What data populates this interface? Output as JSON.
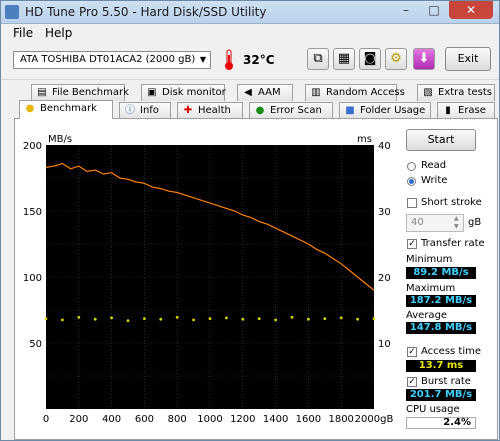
{
  "window": {
    "title": "HD Tune Pro 5.50 - Hard Disk/SSD Utility",
    "minimize": "–",
    "maximize": "□",
    "close": "✕"
  },
  "menu": {
    "file": "File",
    "help": "Help"
  },
  "toolbar": {
    "drive": "ATA     TOSHIBA DT01ACA2 (2000 gB)",
    "temperature": "32°C",
    "exit_label": "Exit"
  },
  "tabs_top": [
    {
      "label": "File Benchmark",
      "icon": "file-icon"
    },
    {
      "label": "Disk monitor",
      "icon": "monitor-icon"
    },
    {
      "label": "AAM",
      "icon": "speaker-icon"
    },
    {
      "label": "Random Access",
      "icon": "random-icon"
    },
    {
      "label": "Extra tests",
      "icon": "tests-icon"
    }
  ],
  "tabs_bottom": [
    {
      "label": "Benchmark",
      "icon": "lightbulb-icon"
    },
    {
      "label": "Info",
      "icon": "info-icon"
    },
    {
      "label": "Health",
      "icon": "health-cross-icon"
    },
    {
      "label": "Error Scan",
      "icon": "magnifier-icon"
    },
    {
      "label": "Folder Usage",
      "icon": "folder-icon"
    },
    {
      "label": "Erase",
      "icon": "erase-icon"
    }
  ],
  "controls": {
    "start": "Start",
    "read": "Read",
    "write": "Write",
    "mode_selected": "write",
    "short_stroke": "Short stroke",
    "short_stroke_checked": false,
    "stroke_value": "40",
    "stroke_unit": "gB",
    "transfer_rate": "Transfer rate",
    "transfer_rate_checked": true,
    "access_time": "Access time",
    "access_time_checked": true,
    "burst_rate": "Burst rate",
    "burst_rate_checked": true
  },
  "stats": {
    "minimum_label": "Minimum",
    "minimum": "89.2 MB/s",
    "maximum_label": "Maximum",
    "maximum": "187.2 MB/s",
    "average_label": "Average",
    "average": "147.8 MB/s",
    "access_time": "13.7 ms",
    "burst_rate": "201.7 MB/s",
    "cpu_label": "CPU usage",
    "cpu": "2.4%"
  },
  "chart_data": {
    "type": "line",
    "y_left_unit": "MB/s",
    "y_right_unit": "ms",
    "x_unit": "gB",
    "ylim_left": [
      0,
      200
    ],
    "ylim_right": [
      0,
      40
    ],
    "xlim": [
      0,
      2000
    ],
    "y_left_ticks": [
      "200",
      "150",
      "100",
      "50"
    ],
    "y_right_ticks": [
      "40",
      "30",
      "20",
      "10"
    ],
    "x_ticks": [
      "0",
      "200",
      "400",
      "600",
      "800",
      "1000",
      "1200",
      "1400",
      "1600",
      "1800",
      "2000gB"
    ],
    "grid": true,
    "series": [
      {
        "kind": "transfer",
        "color": "#ff7f00",
        "x": [
          0,
          50,
          100,
          150,
          200,
          250,
          300,
          350,
          400,
          450,
          500,
          550,
          600,
          650,
          700,
          750,
          800,
          850,
          900,
          950,
          1000,
          1050,
          1100,
          1150,
          1200,
          1250,
          1300,
          1350,
          1400,
          1450,
          1500,
          1550,
          1600,
          1650,
          1700,
          1750,
          1800,
          1850,
          1900,
          1950,
          2000
        ],
        "y": [
          183,
          184,
          186,
          182,
          184,
          180,
          181,
          178,
          179,
          175,
          174,
          172,
          171,
          168,
          167,
          165,
          164,
          162,
          160,
          158,
          156,
          154,
          152,
          150,
          147,
          145,
          142,
          140,
          137,
          134,
          131,
          128,
          125,
          121,
          118,
          114,
          110,
          105,
          100,
          95,
          90
        ]
      },
      {
        "kind": "access",
        "color": "#d8d800",
        "x": [
          0,
          100,
          200,
          300,
          400,
          500,
          600,
          700,
          800,
          900,
          1000,
          1100,
          1200,
          1300,
          1400,
          1500,
          1600,
          1700,
          1800,
          1900,
          2000
        ],
        "y_ms": [
          13.7,
          13.5,
          13.9,
          13.6,
          13.8,
          13.4,
          13.7,
          13.6,
          13.9,
          13.5,
          13.7,
          13.8,
          13.6,
          13.7,
          13.5,
          13.9,
          13.6,
          13.7,
          13.8,
          13.6,
          13.7
        ]
      }
    ]
  }
}
